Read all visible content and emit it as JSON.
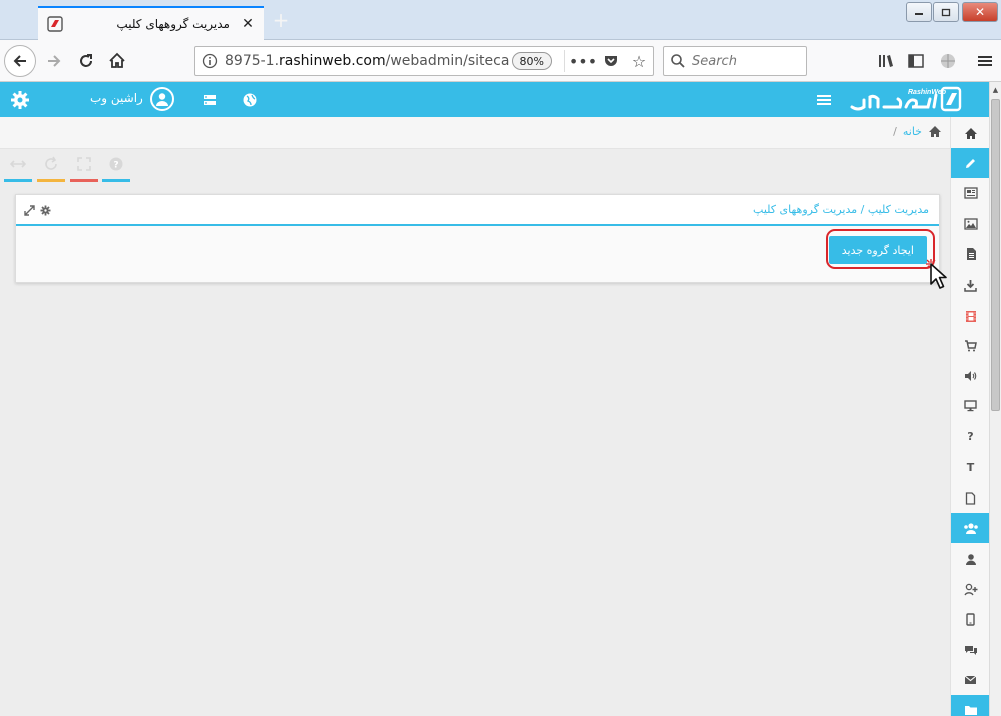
{
  "browser": {
    "tab_title": "مدیریت گروههای کلیپ",
    "url_prefix": "8975-1.",
    "url_host": "rashinweb.com",
    "url_path": "/webadmin/siteca",
    "zoom": "80%",
    "search_placeholder": "Search",
    "new_tab_label": "+"
  },
  "header": {
    "username": "راشین وب",
    "logo_text": "راشین وب",
    "logo_subtext": "RashinWeb",
    "accent_color": "#37bce7"
  },
  "breadcrumb": {
    "home": "خانه",
    "separator": "/"
  },
  "toolbar": {
    "bar_colors": [
      "#37bce7",
      "#f4b53f",
      "#e8625a",
      "#37bce7"
    ]
  },
  "panel": {
    "title": "مدیریت کلیپ / مدیریت گروههای کلیپ",
    "create_button": "ایجاد گروه جدید"
  },
  "sidebar": {
    "items": [
      {
        "icon": "home-icon"
      },
      {
        "icon": "pencil-icon",
        "active": true
      },
      {
        "icon": "news-icon"
      },
      {
        "icon": "image-icon"
      },
      {
        "icon": "document-icon"
      },
      {
        "icon": "download-icon"
      },
      {
        "icon": "film-icon"
      },
      {
        "icon": "cart-icon"
      },
      {
        "icon": "volume-icon"
      },
      {
        "icon": "monitor-icon"
      },
      {
        "icon": "question-icon",
        "glyph": "?"
      },
      {
        "icon": "text-icon",
        "glyph": "T"
      },
      {
        "icon": "page-icon"
      },
      {
        "icon": "users-group-icon",
        "active": true
      },
      {
        "icon": "user-icon"
      },
      {
        "icon": "user-add-icon"
      },
      {
        "icon": "mobile-icon"
      },
      {
        "icon": "comments-icon"
      },
      {
        "icon": "envelope-icon"
      },
      {
        "icon": "folder-icon",
        "active": true
      }
    ]
  }
}
